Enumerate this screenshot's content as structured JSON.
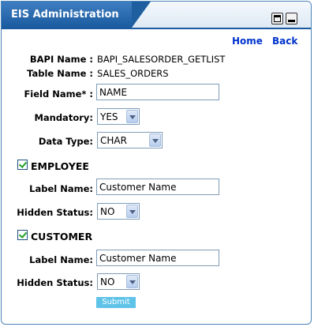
{
  "window": {
    "title": "EIS Administration",
    "maximize_icon": "maximize-icon",
    "minimize_icon": "minimize-icon"
  },
  "nav": {
    "home": "Home",
    "back": "Back"
  },
  "info": {
    "bapi_label": "BAPI Name :",
    "bapi_value": "BAPI_SALESORDER_GETLIST",
    "table_label": "Table Name :",
    "table_value": "SALES_ORDERS"
  },
  "form": {
    "field_name_label": "Field Name* :",
    "field_name_value": "NAME",
    "mandatory_label": "Mandatory:",
    "mandatory_value": "YES",
    "data_type_label": "Data Type:",
    "data_type_value": "CHAR"
  },
  "employee": {
    "title": "EMPLOYEE",
    "checked": true,
    "label_name_label": "Label Name:",
    "label_name_value": "Customer Name",
    "hidden_status_label": "Hidden Status:",
    "hidden_status_value": "NO"
  },
  "customer": {
    "title": "CUSTOMER",
    "checked": true,
    "label_name_label": "Label Name:",
    "label_name_value": "Customer Name",
    "hidden_status_label": "Hidden Status:",
    "hidden_status_value": "NO"
  },
  "submit_label": "Submit",
  "colors": {
    "title_bar": "#1a5a9f",
    "link": "#0033cc",
    "submit": "#5fc3e8",
    "check": "#21a121"
  }
}
